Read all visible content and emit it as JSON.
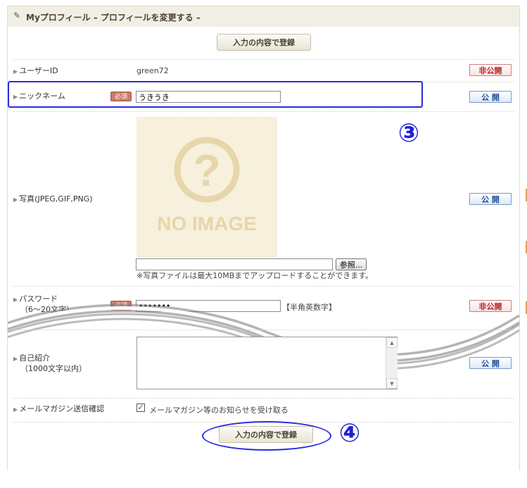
{
  "header": {
    "icon": "pencil-icon",
    "title": "Myプロフィール – プロフィールを変更する –"
  },
  "submit_label": "入力の内容で登録",
  "rows": {
    "user_id": {
      "label": "ユーザーID",
      "value": "green72",
      "visibility": "非公開"
    },
    "nickname": {
      "label": "ニックネーム",
      "required": "必須",
      "value": "うきうき",
      "visibility": "公 開"
    },
    "photo": {
      "label": "写真(JPEG,GIF,PNG)",
      "noimage_text": "NO IMAGE",
      "browse_label": "参照...",
      "note": "※写真ファイルは最大10MBまでアップロードすることができます。",
      "visibility": "公 開"
    },
    "password": {
      "label": "パスワード",
      "sublabel": "（6～20文字）",
      "required": "必須",
      "value": "•••••••",
      "hint": "【半角英数字】",
      "visibility": "非公開"
    },
    "intro": {
      "label": "自己紹介",
      "sublabel": "（1000文字以内）",
      "visibility": "公 開"
    },
    "mail": {
      "label": "メールマガジン送信確認",
      "checkbox_label": "メールマガジン等のお知らせを受け取る",
      "checked": true
    }
  },
  "annotations": {
    "marker_3": "③",
    "marker_4": "④"
  },
  "colors": {
    "accent_blue": "#2b2be0",
    "private_red": "#b52020",
    "public_blue": "#1e4e9a",
    "header_bg": "#f1efe4"
  }
}
